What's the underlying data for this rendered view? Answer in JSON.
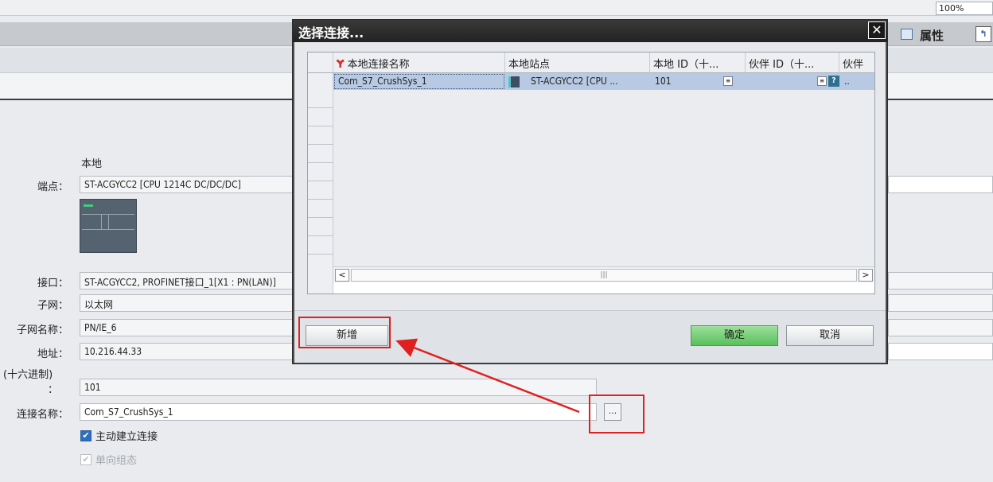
{
  "toolbar": {
    "zoom": "100%"
  },
  "inspector": {
    "properties_label": "属性"
  },
  "form": {
    "section_local": "本地",
    "endpoint_label": "端点：",
    "endpoint_value": "ST-ACGYCC2 [CPU 1214C DC/DC/DC]",
    "interface_label": "接口：",
    "interface_value": "ST-ACGYCC2, PROFINET接口_1[X1 : PN(LAN)]",
    "subnet_label": "子网：",
    "subnet_value": "以太网",
    "subnet_name_label": "子网名称：",
    "subnet_name_value": "PN/IE_6",
    "address_label": "地址：",
    "address_value": "10.216.44.33",
    "hex_label_1": "(十六进制)",
    "hex_label_2": "：",
    "hex_value": "101",
    "conn_name_label": "连接名称：",
    "conn_name_value": "Com_S7_CrushSys_1",
    "browse_label": "...",
    "active_conn_label": "主动建立连接",
    "oneway_label": "单向组态"
  },
  "dialog": {
    "title": "选择连接...",
    "close": "✕",
    "columns": [
      "本地连接名称",
      "本地站点",
      "本地 ID（十...",
      "伙伴 ID（十...",
      "伙伴"
    ],
    "rows": [
      {
        "local_name": "Com_S7_CrushSys_1",
        "local_station": "ST-ACGYCC2 [CPU ...",
        "local_id": "101",
        "partner_id": "",
        "partner": ".."
      }
    ],
    "add_button": "新增",
    "ok_button": "确定",
    "cancel_button": "取消"
  },
  "annotation": {
    "color": "#e02020"
  }
}
